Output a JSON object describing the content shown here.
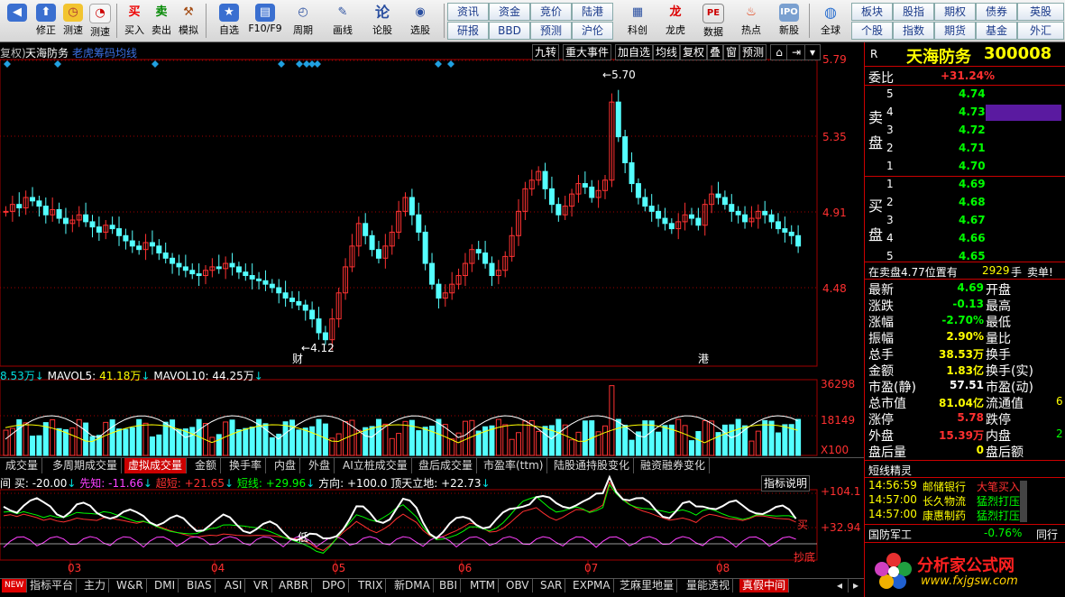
{
  "toolbar": {
    "buttons": [
      {
        "label": "修正",
        "icon": "arrow-up-icon"
      },
      {
        "label": "测速",
        "icon": "clock-icon"
      },
      {
        "label": "买入",
        "icon": "buy-icon",
        "glyph": "买"
      },
      {
        "label": "卖出",
        "icon": "sell-icon",
        "glyph": "卖"
      },
      {
        "label": "模拟",
        "icon": "hammer-icon"
      },
      {
        "label": "自选",
        "icon": "star-icon"
      },
      {
        "label": "F10/F9",
        "icon": "f10-icon"
      },
      {
        "label": "周期",
        "icon": "cycle-icon"
      },
      {
        "label": "画线",
        "icon": "pen-icon"
      },
      {
        "label": "论股",
        "icon": "discuss-icon",
        "glyph": "论"
      },
      {
        "label": "选股",
        "icon": "select-icon"
      }
    ],
    "grid_top": [
      "资讯",
      "资金",
      "竞价",
      "陆港"
    ],
    "grid_bottom": [
      "研报",
      "BBD",
      "预测",
      "沪伦"
    ],
    "buttons2": [
      {
        "label": "科创",
        "icon": "sci-icon"
      },
      {
        "label": "龙虎",
        "icon": "dragon-icon"
      },
      {
        "label": "数据",
        "icon": "data-icon"
      },
      {
        "label": "热点",
        "icon": "hot-icon"
      },
      {
        "label": "新股",
        "icon": "ipo-icon"
      },
      {
        "label": "全球",
        "icon": "globe-icon"
      }
    ],
    "grid2_top": [
      "板块",
      "股指",
      "期权",
      "债券",
      "英股"
    ],
    "grid2_bottom": [
      "个股",
      "指数",
      "期货",
      "基金",
      "外汇"
    ]
  },
  "chart": {
    "header_prefix": "复权)",
    "stock_name": "天海防务",
    "indicator_name": "老虎筹码均线",
    "top_buttons": [
      "九转",
      "重大事件",
      "加自选",
      "均线",
      "复权",
      "叠",
      "窗",
      "预测"
    ],
    "price_axis": [
      "5.79",
      "5.35",
      "4.91",
      "4.48"
    ],
    "high_label": "5.70",
    "low_label": "4.12",
    "event_labels": [
      "财",
      "港"
    ],
    "vol_legend": {
      "vol": "8.53万",
      "ma5_label": "MAVOL5:",
      "ma5": "41.18万",
      "ma10_label": "MAVOL10:",
      "ma10": "44.25万"
    },
    "vol_axis": [
      "36298",
      "18149",
      "X100"
    ],
    "tabs": [
      "成交量",
      "多周期成交量",
      "虚拟成交量",
      "金额",
      "换手率",
      "内盘",
      "外盘",
      "AI立桩成交量",
      "盘后成交量",
      "市盈率(ttm)",
      "陆股通持股变化",
      "融资融券变化"
    ],
    "active_tab": "虚拟成交量",
    "ind_legend": {
      "prefix": "间 买:",
      "buy": "-20.00",
      "xianzhi_label": "先知:",
      "xianzhi": "-11.66",
      "chaoduan_label": "超短:",
      "chaoduan": "+21.65",
      "duanxian_label": "短线:",
      "duanxian": "+29.96",
      "fangxiang_label": "方向:",
      "fangxiang": "+100.0",
      "dingtian_label": "顶天立地:",
      "dingtian": "+22.73"
    },
    "indicator_explain": "指标说明",
    "ind_axis": [
      "+104.1",
      "+32.94"
    ],
    "ind_marks": [
      "低",
      "买",
      "抄底"
    ],
    "months": [
      "03",
      "04",
      "05",
      "06",
      "07",
      "08"
    ],
    "bottom_tabs": [
      "NEW",
      "指标平台",
      "主力",
      "W&R",
      "DMI",
      "BIAS",
      "ASI",
      "VR",
      "ARBR",
      "DPO",
      "TRIX",
      "新DMA",
      "BBI",
      "MTM",
      "OBV",
      "SAR",
      "EXPMA",
      "芝麻里地量",
      "量能透视",
      "真假中间"
    ],
    "active_bottom_tab": "真假中间"
  },
  "quote": {
    "r_label": "R",
    "name": "天海防务",
    "code": "300008",
    "weibi_label": "委比",
    "weibi": "+31.24%",
    "sell_label": [
      "卖",
      "盘"
    ],
    "sell": [
      [
        "5",
        "4.74"
      ],
      [
        "4",
        "4.73"
      ],
      [
        "3",
        "4.72"
      ],
      [
        "2",
        "4.71"
      ],
      [
        "1",
        "4.70"
      ]
    ],
    "buy_label": [
      "买",
      "盘"
    ],
    "buy": [
      [
        "1",
        "4.69"
      ],
      [
        "2",
        "4.68"
      ],
      [
        "3",
        "4.67"
      ],
      [
        "4",
        "4.66"
      ],
      [
        "5",
        "4.65"
      ]
    ],
    "notice": "在卖盘4.77位置有",
    "notice_num": "2929",
    "notice_unit": "手",
    "notice_action": "卖单!",
    "stats": [
      {
        "label": "最新",
        "value": "4.69",
        "right": "开盘",
        "vcolor": "g"
      },
      {
        "label": "涨跌",
        "value": "-0.13",
        "right": "最高",
        "vcolor": "g"
      },
      {
        "label": "涨幅",
        "value": "-2.70%",
        "right": "最低",
        "vcolor": "g"
      },
      {
        "label": "振幅",
        "value": "2.90%",
        "right": "量比",
        "vcolor": "y"
      },
      {
        "label": "总手",
        "value": "38.53万",
        "right": "换手",
        "vcolor": "y"
      },
      {
        "label": "金额",
        "value": "1.83亿",
        "right": "换手(实)",
        "vcolor": "y"
      },
      {
        "label": "市盈(静)",
        "value": "57.51",
        "right": "市盈(动)",
        "vcolor": "w"
      },
      {
        "label": "总市值",
        "value": "81.04亿",
        "right": "流通值",
        "vcolor": "y"
      },
      {
        "label": "涨停",
        "value": "5.78",
        "right": "跌停",
        "vcolor": "r"
      },
      {
        "label": "外盘",
        "value": "15.39万",
        "right": "内盘",
        "vcolor": "r"
      },
      {
        "label": "盘后量",
        "value": "0",
        "right": "盘后额",
        "vcolor": "y"
      }
    ],
    "stat_extra": [
      "6",
      "2"
    ],
    "short_title": "短线精灵",
    "short_items": [
      {
        "time": "14:56:59",
        "name": "邮储银行",
        "action": "大笔买入"
      },
      {
        "time": "14:57:00",
        "name": "长久物流",
        "action": "猛烈打压"
      },
      {
        "time": "14:57:00",
        "name": "康惠制药",
        "action": "猛烈打压"
      }
    ],
    "sector_name": "国防军工",
    "sector_change": "-0.76%",
    "sector_btn": "同行",
    "logo_text": "分析家公式网",
    "logo_url": "www.fxjgsw.com"
  }
}
